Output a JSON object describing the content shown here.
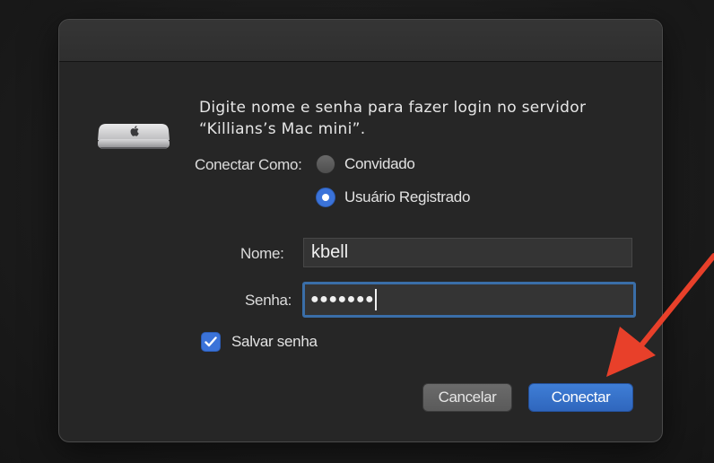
{
  "dialog": {
    "message_line1": "Digite nome e senha para fazer login no servidor",
    "message_line2": "“Killians’s Mac mini”.",
    "connect_as_label": "Conectar Como:",
    "options": [
      {
        "label": "Convidado",
        "selected": false
      },
      {
        "label": "Usuário Registrado",
        "selected": true
      }
    ],
    "name_label": "Nome:",
    "name_value": "kbell",
    "password_label": "Senha:",
    "password_value": "●●●●●●●",
    "save_password_label": "Salvar senha",
    "save_password_checked": true,
    "cancel_label": "Cancelar",
    "connect_label": "Conectar"
  },
  "icons": {
    "server": "mac-mini-icon",
    "annotation": "red-arrow-annotation"
  },
  "colors": {
    "accent": "#3b73d9",
    "focus_ring": "#3a6ea8",
    "annotation": "#e8402a"
  }
}
